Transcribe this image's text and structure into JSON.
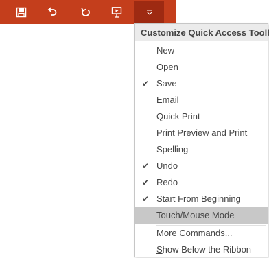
{
  "qat": {
    "buttons": [
      {
        "name": "save-icon"
      },
      {
        "name": "undo-icon"
      },
      {
        "name": "redo-icon"
      },
      {
        "name": "start-from-beginning-icon"
      },
      {
        "name": "customize-dropdown-icon"
      }
    ],
    "accent": "#C43E1C"
  },
  "menu": {
    "title": "Customize Quick Access Toolbar",
    "items": [
      {
        "label": "New",
        "checked": false
      },
      {
        "label": "Open",
        "checked": false
      },
      {
        "label": "Save",
        "checked": true
      },
      {
        "label": "Email",
        "checked": false
      },
      {
        "label": "Quick Print",
        "checked": false
      },
      {
        "label": "Print Preview and Print",
        "checked": false
      },
      {
        "label": "Spelling",
        "checked": false
      },
      {
        "label": "Undo",
        "checked": true
      },
      {
        "label": "Redo",
        "checked": true
      },
      {
        "label": "Start From Beginning",
        "checked": true
      },
      {
        "label": "Touch/Mouse Mode",
        "checked": false,
        "highlighted": true
      }
    ],
    "more_commands": {
      "label": "More Commands...",
      "underline_char": "M"
    },
    "show_below": {
      "label": "Show Below the Ribbon",
      "underline_char": "S"
    },
    "check_glyph": "✔"
  }
}
